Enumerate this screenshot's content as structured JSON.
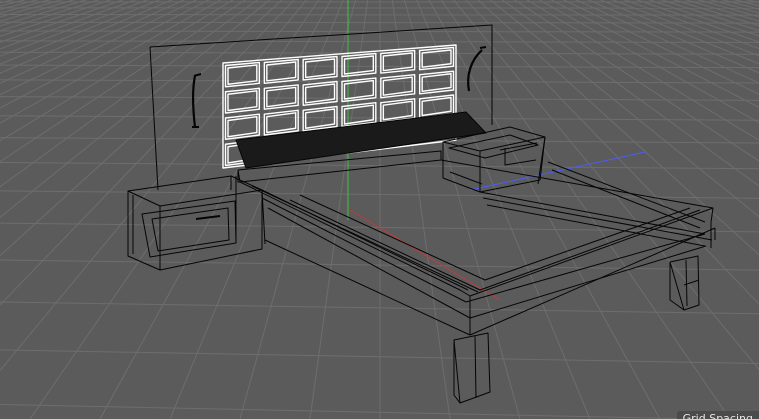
{
  "viewport": {
    "status": {
      "grid_spacing_label": "Grid Spacing"
    },
    "colors": {
      "background": "#5b5b5b",
      "grid_line": "#6c6c6c",
      "wireframe": "#050505",
      "selected_wireframe": "#ffffff",
      "axis_x": "#c33a3a",
      "axis_y": "#3fbf3f",
      "axis_z": "#4c5cff"
    },
    "objects": [
      "headboard-panel",
      "headboard-cushions",
      "mattress-top",
      "bed-frame",
      "nightstand-left",
      "nightstand-right",
      "reading-lamp-left",
      "reading-lamp-right",
      "bed-legs"
    ]
  }
}
